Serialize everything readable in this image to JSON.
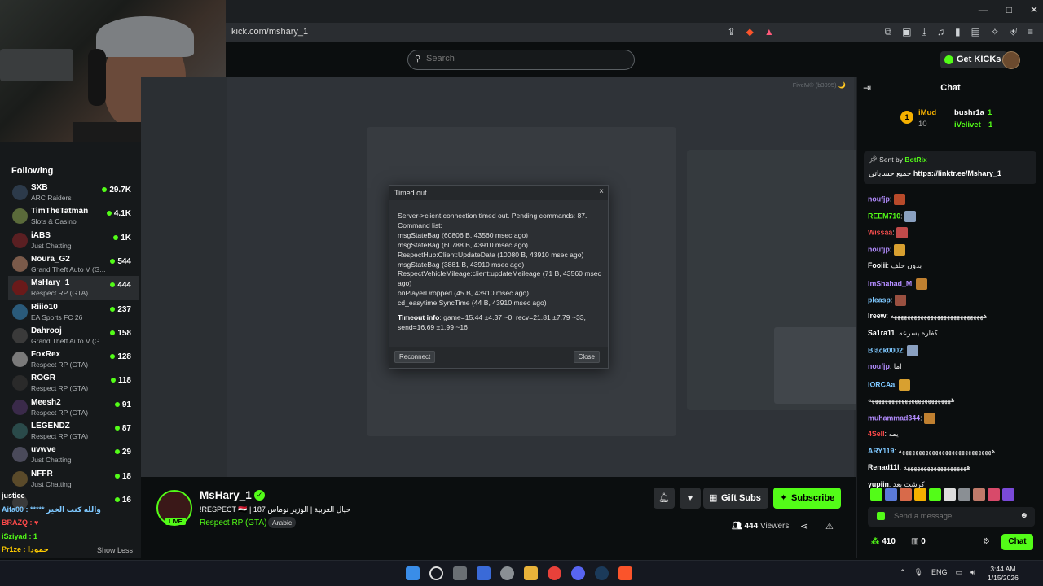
{
  "browser": {
    "url": "kick.com/mshary_1",
    "window_controls": [
      "—",
      "□",
      "✕"
    ]
  },
  "header": {
    "search_placeholder": "Search",
    "get_kicks_label": "Get KICKs"
  },
  "sidebar": {
    "title": "Following",
    "items": [
      {
        "name": "SXB",
        "game": "ARC Raiders",
        "viewers": "29.7K",
        "color": "#2c3a4a"
      },
      {
        "name": "TimTheTatman",
        "game": "Slots & Casino",
        "viewers": "4.1K",
        "color": "#5a6a3a"
      },
      {
        "name": "iABS",
        "game": "Just Chatting",
        "viewers": "1K",
        "color": "#5a1f22"
      },
      {
        "name": "Noura_G2",
        "game": "Grand Theft Auto V (G...",
        "viewers": "544",
        "color": "#7a5a4a"
      },
      {
        "name": "MsHary_1",
        "game": "Respect RP (GTA)",
        "viewers": "444",
        "color": "#6a1a1a"
      },
      {
        "name": "Riiio10",
        "game": "EA Sports FC 26",
        "viewers": "237",
        "color": "#2a5a7a"
      },
      {
        "name": "Dahrooj",
        "game": "Grand Theft Auto V (G...",
        "viewers": "158",
        "color": "#3a3a3a"
      },
      {
        "name": "FoxRex",
        "game": "Respect RP (GTA)",
        "viewers": "128",
        "color": "#7a7a7a"
      },
      {
        "name": "ROGR",
        "game": "Respect RP (GTA)",
        "viewers": "118",
        "color": "#2a2a2a"
      },
      {
        "name": "Meesh2",
        "game": "Respect RP (GTA)",
        "viewers": "91",
        "color": "#3a2a4a"
      },
      {
        "name": "LEGENDZ",
        "game": "Respect RP (GTA)",
        "viewers": "87",
        "color": "#2a4a4a"
      },
      {
        "name": "uvwve",
        "game": "Just Chatting",
        "viewers": "29",
        "color": "#4a4a5a"
      },
      {
        "name": "NFFR",
        "game": "Just Chatting",
        "viewers": "18",
        "color": "#5a4a2a"
      },
      {
        "name": "",
        "game": "",
        "viewers": "16",
        "color": "#3a3a3a"
      }
    ],
    "show_less": "Show Less"
  },
  "overlay_chat": [
    {
      "text": "justice",
      "color": "#ffffff"
    },
    {
      "text": "Aifa00 : ***** والله كنت الخير",
      "color": "#7ec8ff"
    },
    {
      "text": "BRAZQ : ♥",
      "color": "#ff4a4a"
    },
    {
      "text": "iSziyad : 1",
      "color": "#53fc18"
    },
    {
      "text": "Pr1ze : حمودا",
      "color": "#ffcc00"
    },
    {
      "text": "iSziyad : 1",
      "color": "#53fc18"
    }
  ],
  "player": {
    "fivem_badge": "FiveM® (b3095) 🌙",
    "ghost_title": "",
    "ghost_text": ""
  },
  "dialog": {
    "title": "Timed out",
    "lines": [
      "Server->client connection timed out. Pending commands: 87.",
      "Command list:",
      "msgStateBag (60806 B, 43560 msec ago)",
      "msgStateBag (60788 B, 43910 msec ago)",
      "RespectHub:Client:UpdateData (10080 B, 43910 msec ago)",
      "msgStateBag (3881 B, 43910 msec ago)",
      "RespectVehicleMileage:client:updateMeileage (71 B, 43560 msec ago)",
      "onPlayerDropped (45 B, 43910 msec ago)",
      "cd_easytime:SyncTime (44 B, 43910 msec ago)"
    ],
    "timeout_label": "Timeout info",
    "timeout_text": ": game=15.44 ±4.37 ~0, recv=21.81 ±7.79 ~33, send=16.69 ±1.99 ~16",
    "reconnect_label": "Reconnect",
    "close_label": "Close"
  },
  "stream": {
    "name": "MsHary_1",
    "title": "!RESPECT 🇮🇶 | 187 حيال الغربية | الوزير نوماس",
    "category": "Respect RP (GTA)",
    "language": "Arabic",
    "live_label": "LIVE",
    "gift_label": "Gift Subs",
    "subscribe_label": "Subscribe",
    "viewers_count": "444",
    "viewers_label": "Viewers"
  },
  "chat": {
    "title": "Chat",
    "leaderboard": [
      {
        "rank": "1",
        "name": "iMud",
        "count": "10"
      },
      {
        "name": "bushr1a",
        "count": "1"
      },
      {
        "name": "iVelivet",
        "count": "1"
      }
    ],
    "pinned": {
      "sent_by_label": "Sent by",
      "sender": "BotRix",
      "message": "جميع حساباتي",
      "link": "https://linktr.ee/Mshary_1"
    },
    "messages": [
      {
        "user": "noufjp",
        "text": "",
        "color": "#b38cff"
      },
      {
        "user": "REEM710",
        "text": "",
        "color": "#53fc18"
      },
      {
        "user": "Wissaa",
        "text": "",
        "color": "#ff5050"
      },
      {
        "user": "noufjp",
        "text": "",
        "color": "#b38cff"
      },
      {
        "user": "Fooiii",
        "text": "بدون حلف",
        "color": "#ffffff"
      },
      {
        "user": "ImShahad_M",
        "text": "",
        "color": "#b38cff"
      },
      {
        "user": "pleasp",
        "text": "",
        "color": "#7ec8ff"
      },
      {
        "user": "Ireew",
        "text": "ههههههههههههههههههههههههههههه",
        "color": "#ffffff"
      },
      {
        "user": "Sa1ra11",
        "text": "كفاره بسرعه",
        "color": "#ffffff"
      },
      {
        "user": "Black0002",
        "text": "",
        "color": "#7ec8ff"
      },
      {
        "user": "noufjp",
        "text": "اما",
        "color": "#b38cff"
      },
      {
        "user": "iORCAa",
        "text": "",
        "color": "#7ec8ff"
      },
      {
        "user": "",
        "text": "هههههههههههههههههههههههههه",
        "color": "#ffffff"
      },
      {
        "user": "muhammad344",
        "text": "",
        "color": "#b38cff"
      },
      {
        "user": "4Sell",
        "text": "يمه",
        "color": "#ff4a4a"
      },
      {
        "user": "ARY119",
        "text": "ههههههههههههههههههههههههههههه",
        "color": "#7ec8ff"
      },
      {
        "user": "Renad11l",
        "text": "هههههههههههههههههههه",
        "color": "#ffffff"
      },
      {
        "user": "yupiin",
        "text": "كرشت بعد",
        "color": "#ffffff"
      }
    ],
    "send_placeholder": "Send a message",
    "points": "410",
    "gifts": "0",
    "chat_button": "Chat"
  },
  "taskbar": {
    "lang": "ENG",
    "time": "3:44 AM",
    "date": "1/15/2026"
  }
}
